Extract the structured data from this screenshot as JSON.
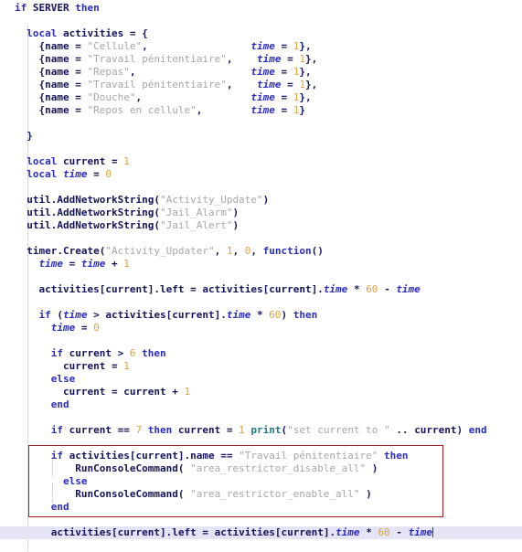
{
  "editor": {
    "language": "lua",
    "background_color": "#ffffff",
    "current_line_highlight_color": "#e4e4f4",
    "annotation_box_color": "#a31f22",
    "caret_color": "#2b2bc0",
    "colors": {
      "keyword": "#2b2bc0",
      "string": "#a6a6a6",
      "number": "#d9a441",
      "identifier": "#14145a",
      "library_function": "#1b7b8c",
      "indent_guide": "#b9b9b9"
    }
  },
  "code": {
    "lines": [
      "if SERVER then",
      "",
      "  local activities = {",
      "    {name = \"Cellule\",                 time = 1},",
      "    {name = \"Travail pénitentiaire\",    time = 1},",
      "    {name = \"Repas\",                   time = 1},",
      "    {name = \"Travail pénitentiaire\",    time = 1},",
      "    {name = \"Douche\",                  time = 1},",
      "    {name = \"Repos en cellule\",         time = 1}",
      "",
      "  }",
      "",
      "  local current = 1",
      "  local time = 0",
      "",
      "  util.AddNetworkString(\"Activity_Update\")",
      "  util.AddNetworkString(\"Jail_Alarm\")",
      "  util.AddNetworkString(\"Jail_Alert\")",
      "",
      "  timer.Create(\"Activity_Updater\", 1, 0, function()",
      "    time = time + 1",
      "",
      "    activities[current].left = activities[current].time * 60 - time",
      "",
      "    if (time > activities[current].time * 60) then",
      "      time = 0",
      "",
      "      if current > 6 then",
      "        current = 1",
      "      else",
      "        current = current + 1",
      "      end",
      "",
      "      if current == 7 then current = 1 print(\"set current to \" .. current) end",
      "",
      "      if activities[current].name == \"Travail pénitentiaire\" then",
      "          RunConsoleCommand( \"area_restrictor_disable_all\" )",
      "        else",
      "          RunConsoleCommand( \"area_restrictor_enable_all\" )",
      "      end",
      "",
      "      activities[current].left = activities[current].time * 60 - time"
    ],
    "activities_table": [
      {
        "name": "Cellule",
        "time": 1
      },
      {
        "name": "Travail pénitentiaire",
        "time": 1
      },
      {
        "name": "Repas",
        "time": 1
      },
      {
        "name": "Travail pénitentiaire",
        "time": 1
      },
      {
        "name": "Douche",
        "time": 1
      },
      {
        "name": "Repos en cellule",
        "time": 1
      }
    ],
    "network_strings": [
      "Activity_Update",
      "Jail_Alarm",
      "Jail_Alert"
    ],
    "timer_name": "Activity_Updater",
    "timer_delay": 1,
    "timer_repetitions": 0,
    "console_commands": [
      "area_restrictor_disable_all",
      "area_restrictor_enable_all"
    ],
    "print_message": "set current to ",
    "current_initial": 1,
    "time_initial": 0,
    "wrap_threshold": 6,
    "reset_value": 7,
    "seconds_multiplier": 60,
    "current_line_index": 40
  }
}
